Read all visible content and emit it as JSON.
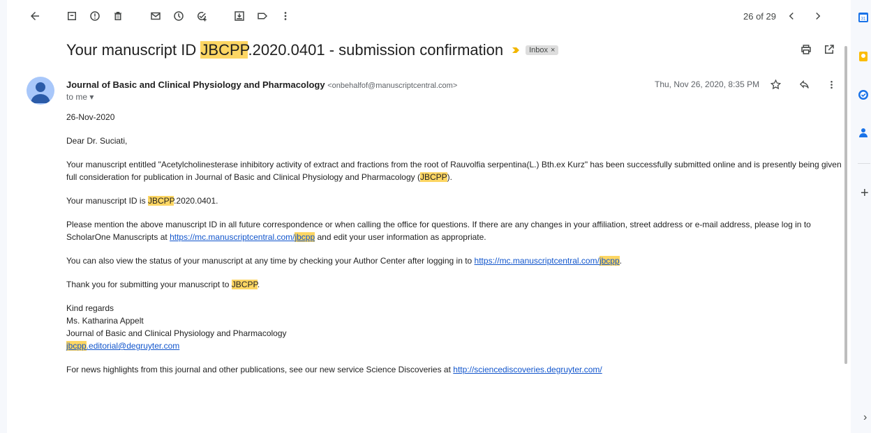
{
  "toolbar": {
    "icons": [
      "back-arrow-icon",
      "archive-icon",
      "report-spam-icon",
      "delete-icon",
      "mark-unread-icon",
      "snooze-icon",
      "add-task-icon",
      "move-to-icon",
      "label-icon",
      "more-vert-icon"
    ],
    "pager": "26 of 29"
  },
  "email": {
    "subject_pre": "Your manuscript ID ",
    "subject_hl": "JBCPP",
    "subject_post": ".2020.0401 - submission confirmation",
    "label": "Inbox",
    "label_close": "×",
    "sender_name": "Journal of Basic and Clinical Physiology and Pharmacology",
    "sender_email": "<onbehalfof@manuscriptcentral.com>",
    "to": "to me ▾",
    "date": "Thu, Nov 26, 2020, 8:35 PM"
  },
  "body": {
    "date_line": "26-Nov-2020",
    "greeting": "Dear Dr. Suciati,",
    "p1_a": "Your manuscript entitled \"Acetylcholinesterase inhibitory activity of extract and fractions from the root of Rauvolfia serpentina(L.) Bth.ex Kurz\" has been successfully submitted online and is presently being given full consideration for publication in Journal of Basic and Clinical Physiology and Pharmacology (",
    "p1_hl": "JBCPP",
    "p1_b": ").",
    "p2_a": "Your manuscript ID is ",
    "p2_hl": "JBCPP",
    "p2_b": ".2020.0401.",
    "p3_a": "Please mention the above manuscript ID in all future correspondence or when calling the office for questions. If there are any changes in your affiliation, street address or e-mail address, please log in to ScholarOne Manuscripts at ",
    "p3_link_a": "https://mc.manuscriptcentral.com/",
    "p3_link_hl": "jbcpp",
    "p3_b": " and edit your user information as appropriate.",
    "p4_a": "You can also view the status of your manuscript at any time by checking your Author Center after logging in to ",
    "p4_link_a": "https://mc.manuscriptcentral.com/",
    "p4_link_hl": "jbcpp",
    "p4_b": ".",
    "p5_a": "Thank you for submitting your manuscript to ",
    "p5_hl": "JBCPP",
    "p5_b": ".",
    "sig_1": "Kind regards",
    "sig_2": "Ms. Katharina Appelt",
    "sig_3": "Journal of Basic and Clinical Physiology and Pharmacology",
    "sig_email_hl": "jbcpp",
    "sig_email_rest": ".editorial@degruyter.com",
    "p6_a": "For news highlights from this journal and other publications, see our new service Science Discoveries at ",
    "p6_link": "http://sciencediscoveries.degruyter.com/"
  },
  "side_panel": {
    "icons": [
      "calendar-icon",
      "keep-icon",
      "tasks-icon",
      "contacts-icon",
      "add-icon",
      "expand-icon"
    ],
    "calendar_day": "31",
    "add": "+",
    "expand": "›"
  },
  "colors": {
    "highlight": "#fdd663",
    "link": "#1155cc",
    "importance": "#f2b600"
  }
}
